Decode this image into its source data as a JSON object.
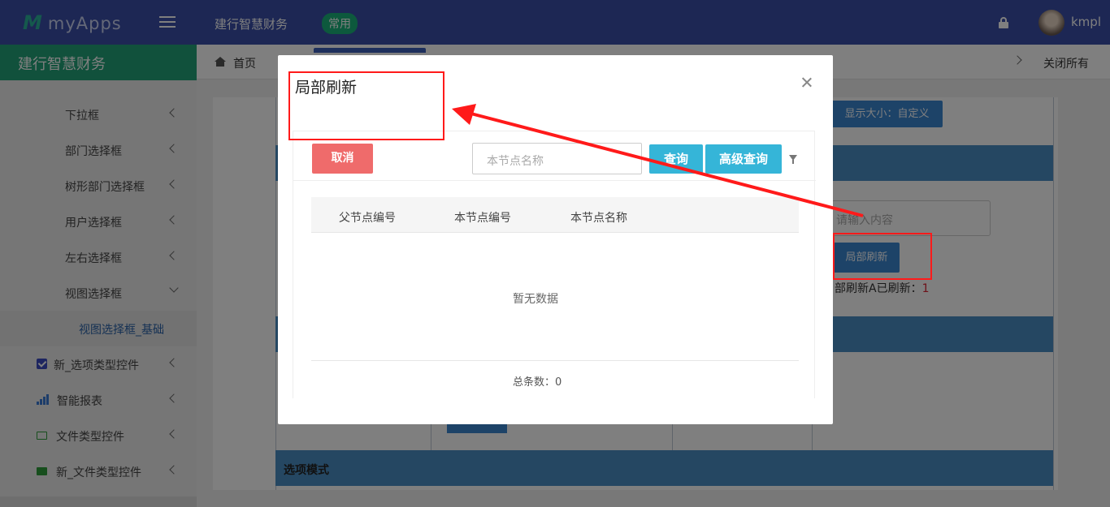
{
  "topbar": {
    "logo_mark": "M",
    "logo_text": "myApps",
    "app_name": "建行智慧财务",
    "badge": "常用",
    "username": "kmpl"
  },
  "sidebar": {
    "title": "建行智慧财务",
    "items": [
      {
        "label": "下拉框"
      },
      {
        "label": "部门选择框"
      },
      {
        "label": "树形部门选择框"
      },
      {
        "label": "用户选择框"
      },
      {
        "label": "左右选择框"
      },
      {
        "label": "视图选择框"
      },
      {
        "label": "视图选择框_基础"
      },
      {
        "label": "新_选项类型控件",
        "icon": "checkbox-icon"
      },
      {
        "label": "智能报表",
        "icon": "bar-chart-icon"
      },
      {
        "label": "文件类型控件",
        "icon": "folder-open-icon"
      },
      {
        "label": "新_文件类型控件",
        "icon": "folder-icon"
      }
    ]
  },
  "tabs": {
    "home": "首页",
    "close_all": "关闭所有"
  },
  "background": {
    "display_size_button": "显示大小：自定义",
    "input_placeholder": "请输入内容",
    "refresh_button": "局部刷新",
    "refresh_status_label": "部刷新A已刷新：",
    "refresh_status_count": "1",
    "section_title": "选项模式"
  },
  "modal": {
    "title": "局部刷新",
    "cancel_button": "取消",
    "search_placeholder": "本节点名称",
    "query_button": "查询",
    "advanced_query_button": "高级查询",
    "columns": [
      "父节点编号",
      "本节点编号",
      "本节点名称"
    ],
    "empty_text": "暂无数据",
    "total_label": "总条数：0"
  },
  "colors": {
    "topbar": "#3a4fa8",
    "sidebar_head": "#23a279",
    "annotation": "#ff1a1a",
    "cancel": "#ef6b6b",
    "query": "#35b5d8"
  }
}
